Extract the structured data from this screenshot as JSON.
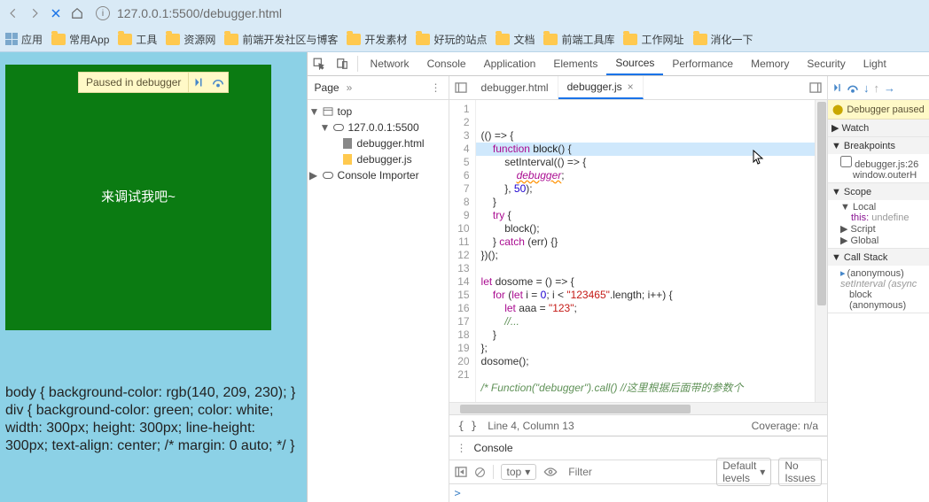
{
  "url": "127.0.0.1:5500/debugger.html",
  "bookmarks": [
    "应用",
    "常用App",
    "工具",
    "资源网",
    "前端开发社区与博客",
    "开发素材",
    "好玩的站点",
    "文档",
    "前端工具库",
    "工作网址",
    "消化一下"
  ],
  "viewport": {
    "box_text": "来调试我吧~",
    "paused_text": "Paused in debugger",
    "css_dump": "body { background-color: rgb(140, 209, 230); } div { background-color: green; color: white; width: 300px; height: 300px; line-height: 300px; text-align: center; /* margin: 0 auto; */ }"
  },
  "devtools": {
    "tabs": [
      "Network",
      "Console",
      "Application",
      "Elements",
      "Sources",
      "Performance",
      "Memory",
      "Security",
      "Light"
    ],
    "active_tab": "Sources",
    "page_label": "Page",
    "tree": {
      "top": "top",
      "origin": "127.0.0.1:5500",
      "files": [
        "debugger.html",
        "debugger.js"
      ],
      "importer": "Console Importer"
    },
    "open_files": [
      "debugger.html",
      "debugger.js"
    ],
    "active_file": "debugger.js",
    "status_left": "Line 4, Column 13",
    "status_right": "Coverage: n/a",
    "code_lines": 21
  },
  "debugger": {
    "banner": "Debugger paused",
    "sections": {
      "watch": "Watch",
      "breakpoints": "Breakpoints",
      "bp_item": "debugger.js:26",
      "bp_code": "window.outerH",
      "scope": "Scope",
      "local": "Local",
      "this_lbl": "this:",
      "this_val": "undefine",
      "script": "Script",
      "global": "Global",
      "callstack": "Call Stack",
      "frames": [
        "(anonymous)",
        "setInterval (async",
        "block",
        "(anonymous)"
      ]
    }
  },
  "console": {
    "title": "Console",
    "top": "top",
    "filter_placeholder": "Filter",
    "levels": "Default levels",
    "issues": "No Issues",
    "prompt": ">"
  }
}
